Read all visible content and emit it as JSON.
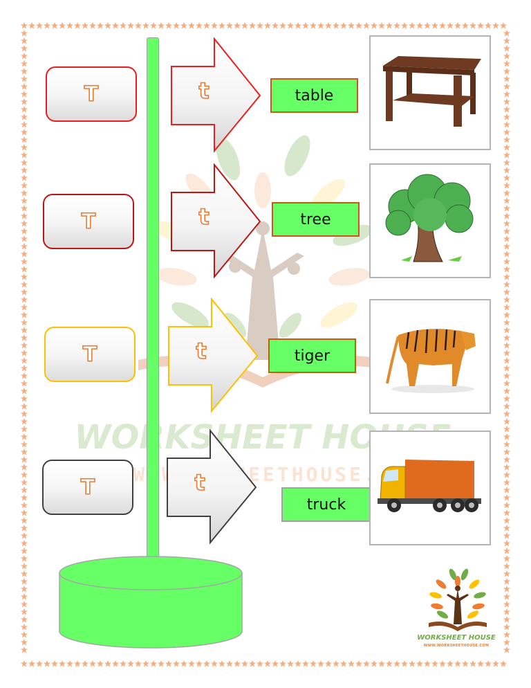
{
  "worksheet": {
    "letter_upper": "T",
    "letter_lower": "t",
    "rows": [
      {
        "upper": "T",
        "lower": "t",
        "word": "table",
        "picture": "table-picture",
        "color": "#ee1c1c"
      },
      {
        "upper": "T",
        "lower": "t",
        "word": "tree",
        "picture": "tree-picture",
        "color": "#c01414"
      },
      {
        "upper": "T",
        "lower": "t",
        "word": "tiger",
        "picture": "tiger-picture",
        "color": "#ffc000"
      },
      {
        "upper": "T",
        "lower": "t",
        "word": "truck",
        "picture": "truck-picture",
        "color": "#404040"
      }
    ]
  },
  "branding": {
    "name": "WORKSHEET HOUSE",
    "url": "WWW.WORKSHEETHOUSE.COM",
    "watermark_name": "WORKSHEET HOUSE",
    "watermark_url": "WWW.WORKSHEETHOUSE.COM"
  },
  "colors": {
    "border_star": "#f5ae80",
    "pole_green": "#66ff66",
    "letter_orange": "#ee7a2e",
    "word_border": "#c55a11"
  }
}
